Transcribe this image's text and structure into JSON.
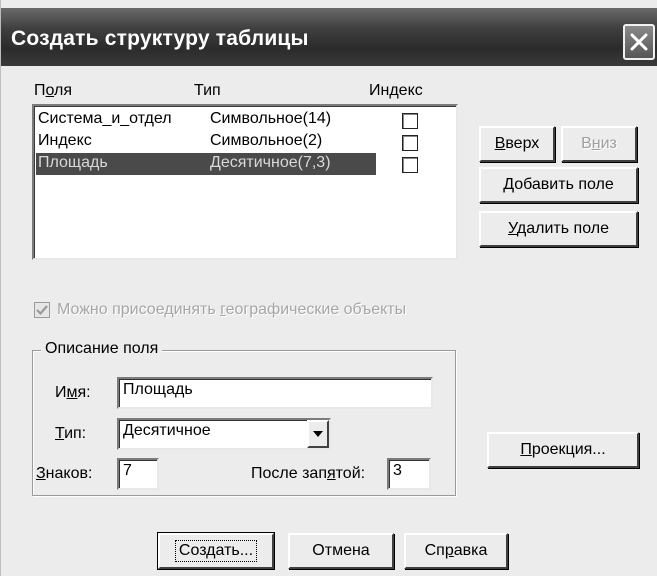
{
  "window": {
    "title": "Создать структуру таблицы",
    "close_icon": "close-x-icon"
  },
  "fields_table": {
    "headers": {
      "name": "Поля",
      "name_hotkey": "о",
      "type": "Тип",
      "index": "Индекс"
    },
    "rows": [
      {
        "name": "Система_и_отдел",
        "type": "Символьное(14)",
        "index": false,
        "selected": false
      },
      {
        "name": "Индекс",
        "type": "Символьное(2)",
        "index": false,
        "selected": false
      },
      {
        "name": "Площадь",
        "type": "Десятичное(7,3)",
        "index": false,
        "selected": true
      }
    ]
  },
  "buttons": {
    "up": {
      "hotkey": "В",
      "rest": "верх"
    },
    "down": {
      "pre": "В",
      "hotkey": "н",
      "rest": "из"
    },
    "add": {
      "hotkey": "Д",
      "rest": "обавить поле"
    },
    "remove": {
      "hotkey": "У",
      "rest": "далить поле"
    },
    "projection": {
      "hotkey": "П",
      "rest": "роекция..."
    },
    "create": "Создать...",
    "cancel": "Отмена",
    "help": {
      "pre": "Сп",
      "hotkey": "р",
      "rest": "авка"
    }
  },
  "geo_checkbox": {
    "pre": "Можно присоединять ",
    "hotkey": "г",
    "rest": "еографические объекты",
    "checked": true,
    "enabled": false
  },
  "field_description": {
    "title": "Описание поля",
    "name_label": {
      "pre": "И",
      "hotkey": "м",
      "rest": "я:"
    },
    "name_value": "Площадь",
    "type_label": {
      "hotkey": "Т",
      "rest": "ип:"
    },
    "type_value": "Десятичное",
    "digits_label": {
      "hotkey": "З",
      "rest": "наков:"
    },
    "digits_value": "7",
    "decimals_label": {
      "pre": "После зап",
      "hotkey": "я",
      "rest": "той:"
    },
    "decimals_value": "3"
  }
}
